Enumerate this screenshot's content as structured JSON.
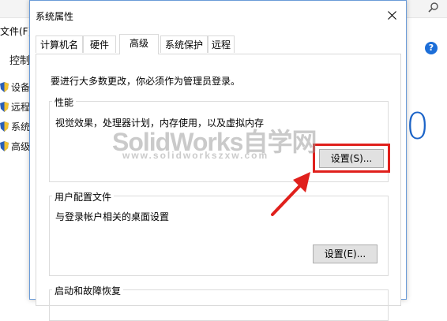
{
  "background": {
    "file_menu": "文件(F)",
    "control_label": "控制",
    "help_glyph": "?",
    "big_digit": "0",
    "side_items": [
      "设备",
      "远程",
      "系统",
      "高级"
    ]
  },
  "dialog": {
    "title": "系统属性",
    "tabs": [
      {
        "label": "计算机名"
      },
      {
        "label": "硬件"
      },
      {
        "label": "高级"
      },
      {
        "label": "系统保护"
      },
      {
        "label": "远程"
      }
    ],
    "active_tab": "高级",
    "admin_note": "要进行大多数更改，你必须作为管理员登录。",
    "performance": {
      "title": "性能",
      "description": "视觉效果，处理器计划，内存使用，以及虚拟内存",
      "button": "设置(S)..."
    },
    "user_profiles": {
      "title": "用户配置文件",
      "description": "与登录帐户相关的桌面设置",
      "button": "设置(E)..."
    },
    "startup": {
      "title": "启动和故障恢复"
    }
  },
  "watermark": {
    "main": "SolidWorks自学网",
    "sub": "www.solidworkszxw.com"
  },
  "colors": {
    "highlight": "#e0201c",
    "accent_blue": "#1c64c8"
  }
}
